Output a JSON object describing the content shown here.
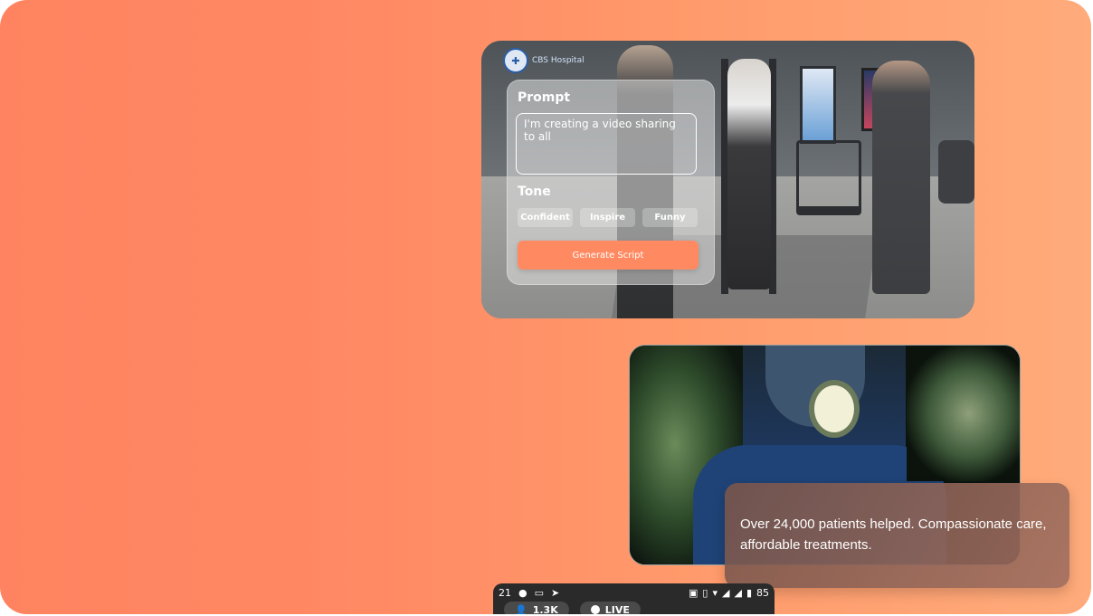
{
  "top_card": {
    "logo_text": "CBS Hospital"
  },
  "prompt_panel": {
    "prompt_label": "Prompt",
    "prompt_value": "I'm creating a video sharing to all",
    "tone_label": "Tone",
    "tone_options": [
      "Confident",
      "Inspire",
      "Funny"
    ],
    "generate_label": "Generate Script"
  },
  "caption": {
    "text": "Over 24,000 patients helped. Compassionate care, affordable treatments."
  },
  "phone": {
    "time": "21",
    "battery": "85",
    "viewers": "1.3K",
    "live_label": "LIVE"
  },
  "colors": {
    "background_start": "#ff8360",
    "background_end": "#ffab7b",
    "accent_button": "#ff8a62"
  }
}
